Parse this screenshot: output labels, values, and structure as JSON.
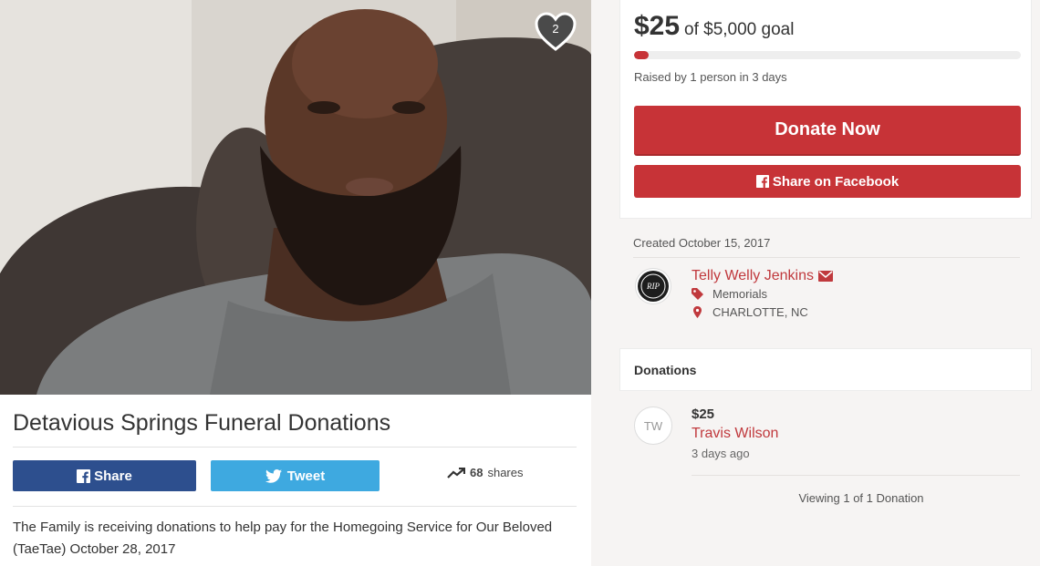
{
  "campaign": {
    "title": "Detavious Springs Funeral Donations",
    "description": "The Family is receiving donations to help pay for the Homegoing Service for Our Beloved (TaeTae) October 28, 2017",
    "heart_count": "2"
  },
  "social": {
    "share_label": "Share",
    "tweet_label": "Tweet",
    "shares_count": "68",
    "shares_suffix": "shares"
  },
  "fundraising": {
    "raised_amount": "$25",
    "goal_text": "of $5,000 goal",
    "progress_fraction": 0.005,
    "raised_by": "Raised by 1 person in 3 days",
    "donate_label": "Donate Now",
    "fb_share_label": "Share on Facebook"
  },
  "organizer": {
    "created": "Created October 15, 2017",
    "name": "Telly Welly Jenkins",
    "category": "Memorials",
    "location": "CHARLOTTE, NC",
    "logo_text": "RIP"
  },
  "donations": {
    "title": "Donations",
    "items": [
      {
        "initials": "TW",
        "amount": "$25",
        "name": "Travis Wilson",
        "time": "3 days ago"
      }
    ],
    "viewing": "Viewing 1 of 1 Donation"
  },
  "colors": {
    "brand_red": "#c73337",
    "facebook_blue": "#2d4f8e",
    "twitter_blue": "#3ea9e0"
  }
}
